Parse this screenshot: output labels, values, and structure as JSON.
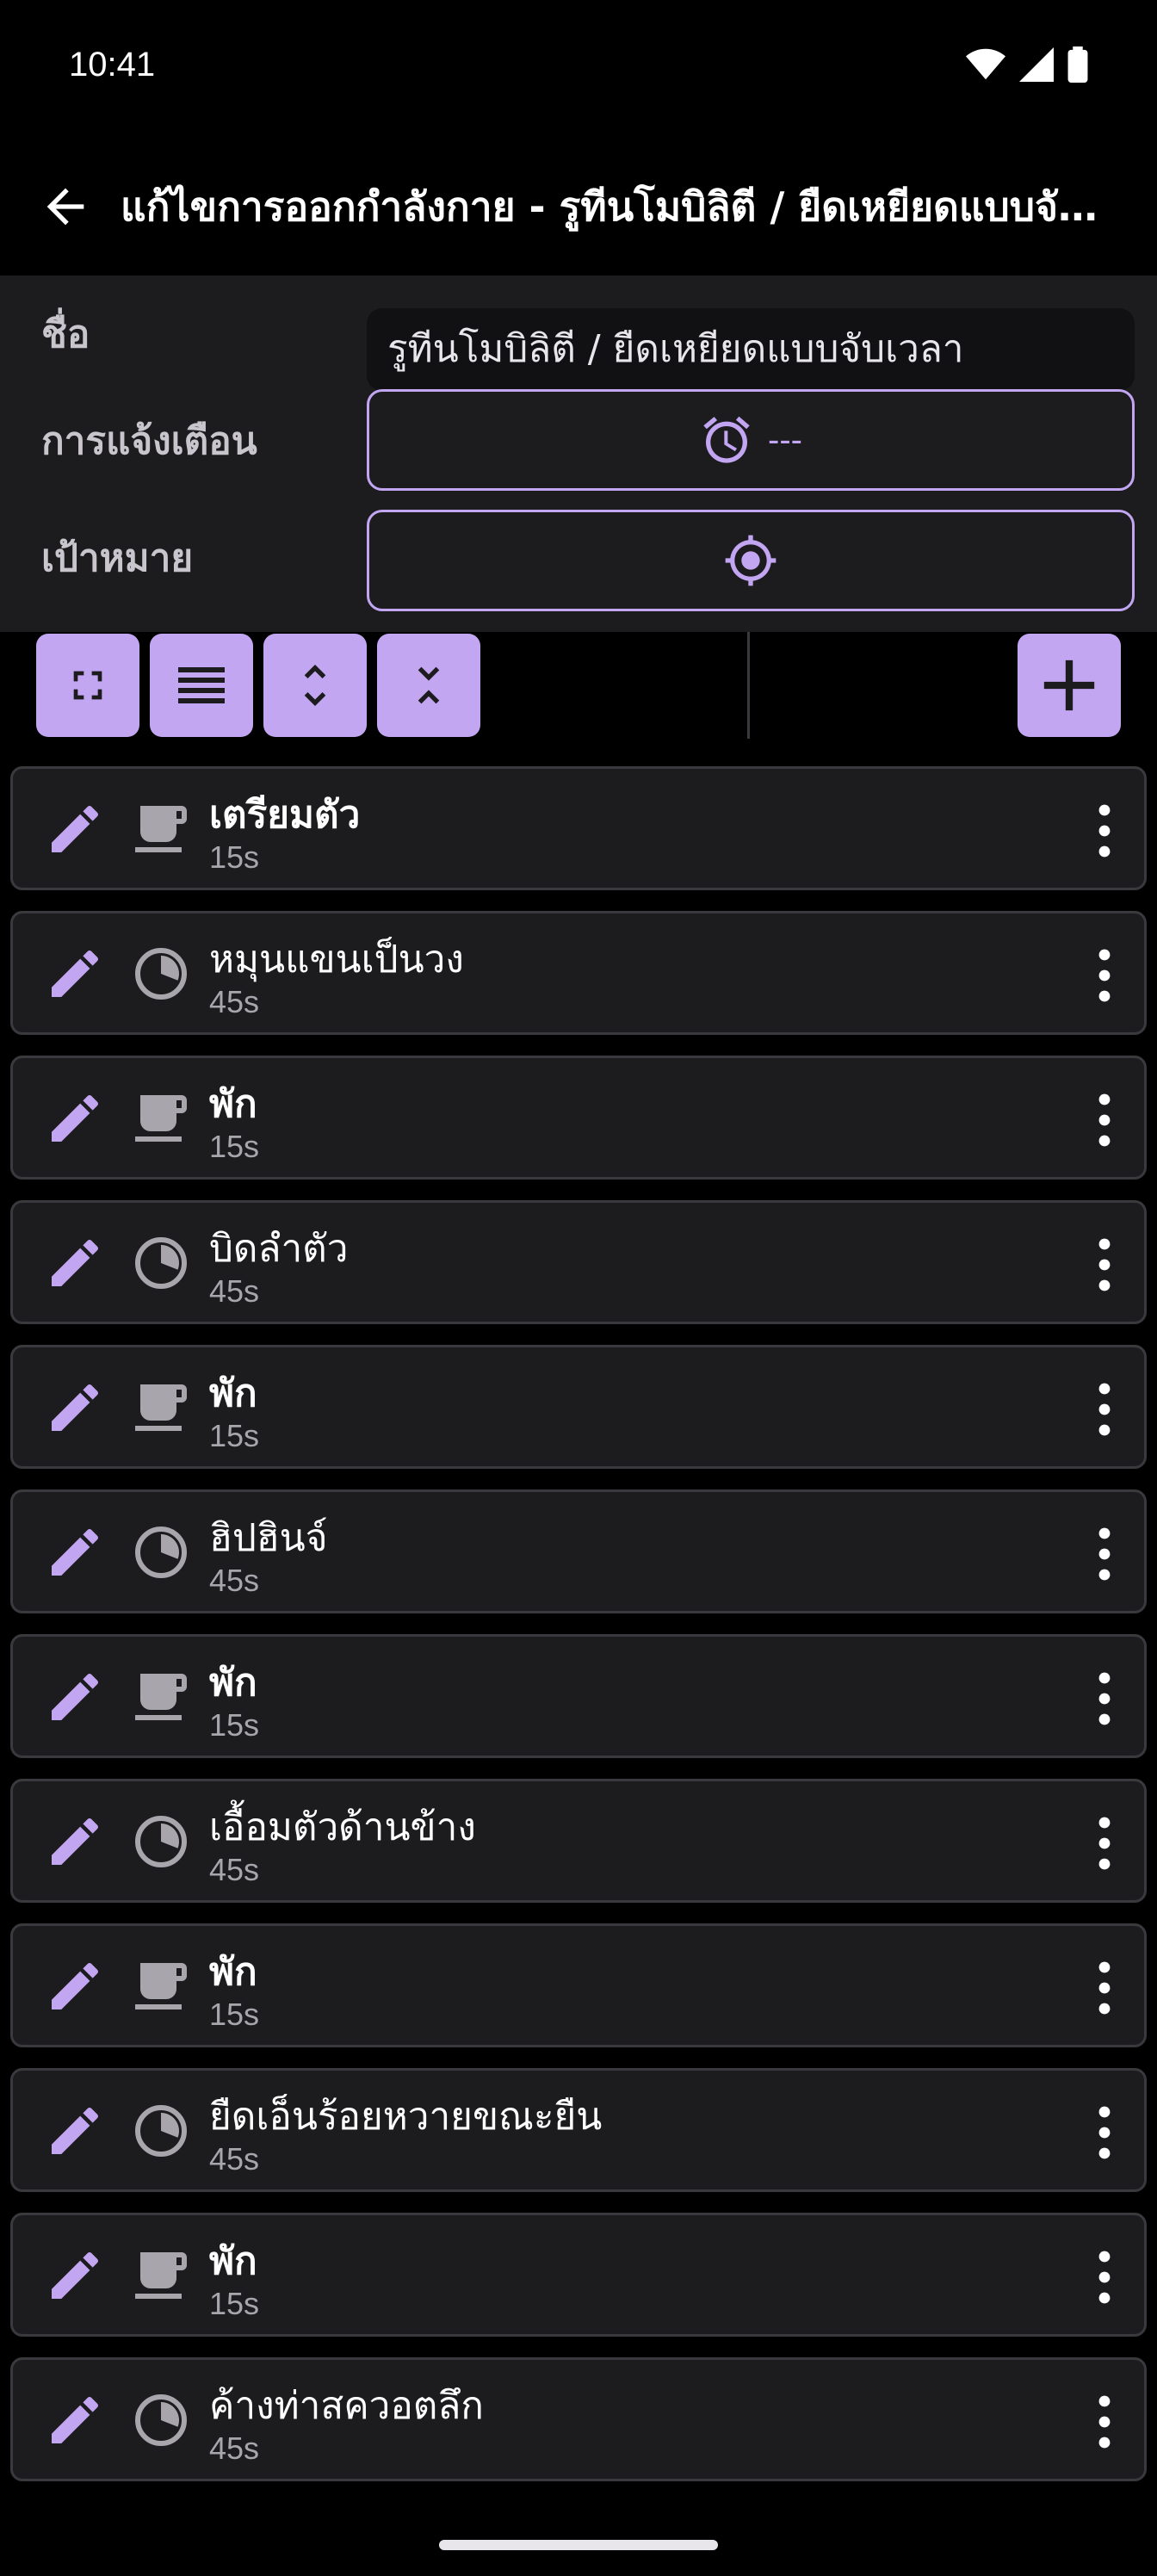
{
  "status": {
    "time": "10:41"
  },
  "appbar": {
    "title": "แก้ไขการออกกำลังกาย - รูทีนโมบิลิตี / ยืดเหยียดแบบจับเวลา"
  },
  "form": {
    "name_label": "ชื่อ",
    "name_value": "รูทีนโมบิลิตี / ยืดเหยียดแบบจับเวลา",
    "reminder_label": "การแจ้งเตือน",
    "reminder_value": "---",
    "target_label": "เป้าหมาย"
  },
  "toolbar": {
    "buttons": [
      "fullscreen-icon",
      "menu-lines-icon",
      "expand-icon",
      "collapse-icon"
    ],
    "add": "plus-icon"
  },
  "items": [
    {
      "name": "เตรียมตัว",
      "duration": "15s",
      "kind": "rest"
    },
    {
      "name": "หมุนแขนเป็นวง",
      "duration": "45s",
      "kind": "timer"
    },
    {
      "name": "พัก",
      "duration": "15s",
      "kind": "rest"
    },
    {
      "name": "บิดลำตัว",
      "duration": "45s",
      "kind": "timer"
    },
    {
      "name": "พัก",
      "duration": "15s",
      "kind": "rest"
    },
    {
      "name": "ฮิปฮินจ์",
      "duration": "45s",
      "kind": "timer"
    },
    {
      "name": "พัก",
      "duration": "15s",
      "kind": "rest"
    },
    {
      "name": "เอื้อมตัวด้านข้าง",
      "duration": "45s",
      "kind": "timer"
    },
    {
      "name": "พัก",
      "duration": "15s",
      "kind": "rest"
    },
    {
      "name": "ยืดเอ็นร้อยหวายขณะยืน",
      "duration": "45s",
      "kind": "timer"
    },
    {
      "name": "พัก",
      "duration": "15s",
      "kind": "rest"
    },
    {
      "name": "ค้างท่าสควอตลึก",
      "duration": "45s",
      "kind": "timer"
    }
  ],
  "colors": {
    "accent": "#c3a6f2",
    "surface": "#1c1c1f",
    "outline": "#3a3a3e",
    "background": "#000000"
  }
}
